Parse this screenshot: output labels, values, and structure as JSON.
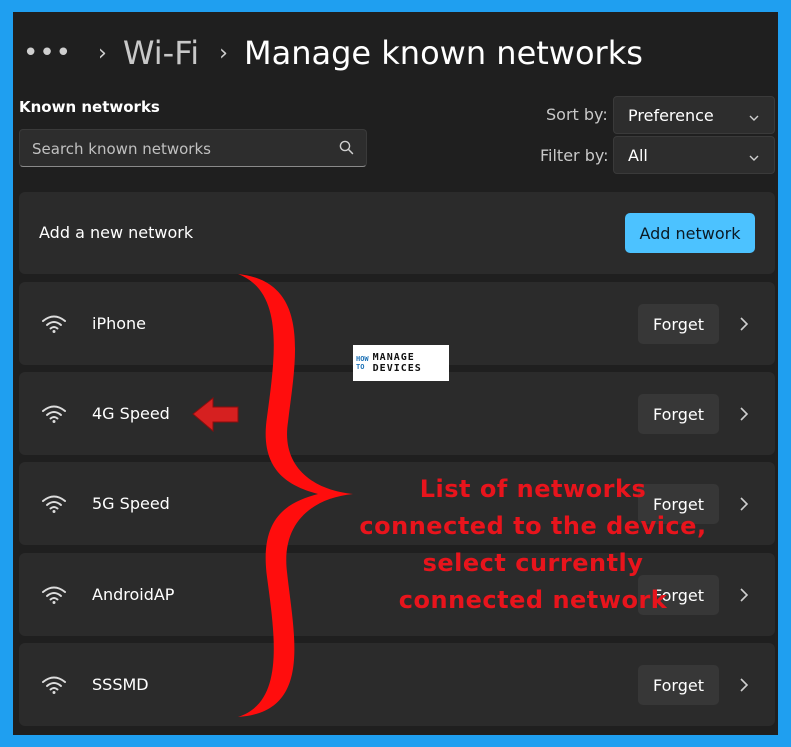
{
  "breadcrumb": {
    "more_label": "•••",
    "sep1": "›",
    "wifi": "Wi-Fi",
    "sep2": "›",
    "title": "Manage known networks"
  },
  "known_networks_label": "Known networks",
  "search": {
    "placeholder": "Search known networks",
    "icon": "search-icon"
  },
  "sort": {
    "label": "Sort by:",
    "value": "Preference"
  },
  "filter": {
    "label": "Filter by:",
    "value": "All"
  },
  "add_card": {
    "label": "Add a new network",
    "button": "Add network"
  },
  "networks": [
    {
      "name": "iPhone",
      "forget": "Forget"
    },
    {
      "name": "4G Speed",
      "forget": "Forget"
    },
    {
      "name": "5G Speed",
      "forget": "Forget"
    },
    {
      "name": "AndroidAP",
      "forget": "Forget"
    },
    {
      "name": "SSSMD",
      "forget": "Forget"
    }
  ],
  "watermark": {
    "how": "HOW",
    "to": "TO",
    "manage": "MANAGE",
    "devices": "DEVICES"
  },
  "annotation": {
    "lines": [
      "List of networks",
      "connected to the device,",
      "select currently",
      "connected network"
    ]
  },
  "colors": {
    "background": "#1f1f1f",
    "border_frame": "#1f9ff0",
    "accent": "#4cc2ff",
    "annotation": "#e8141c"
  }
}
